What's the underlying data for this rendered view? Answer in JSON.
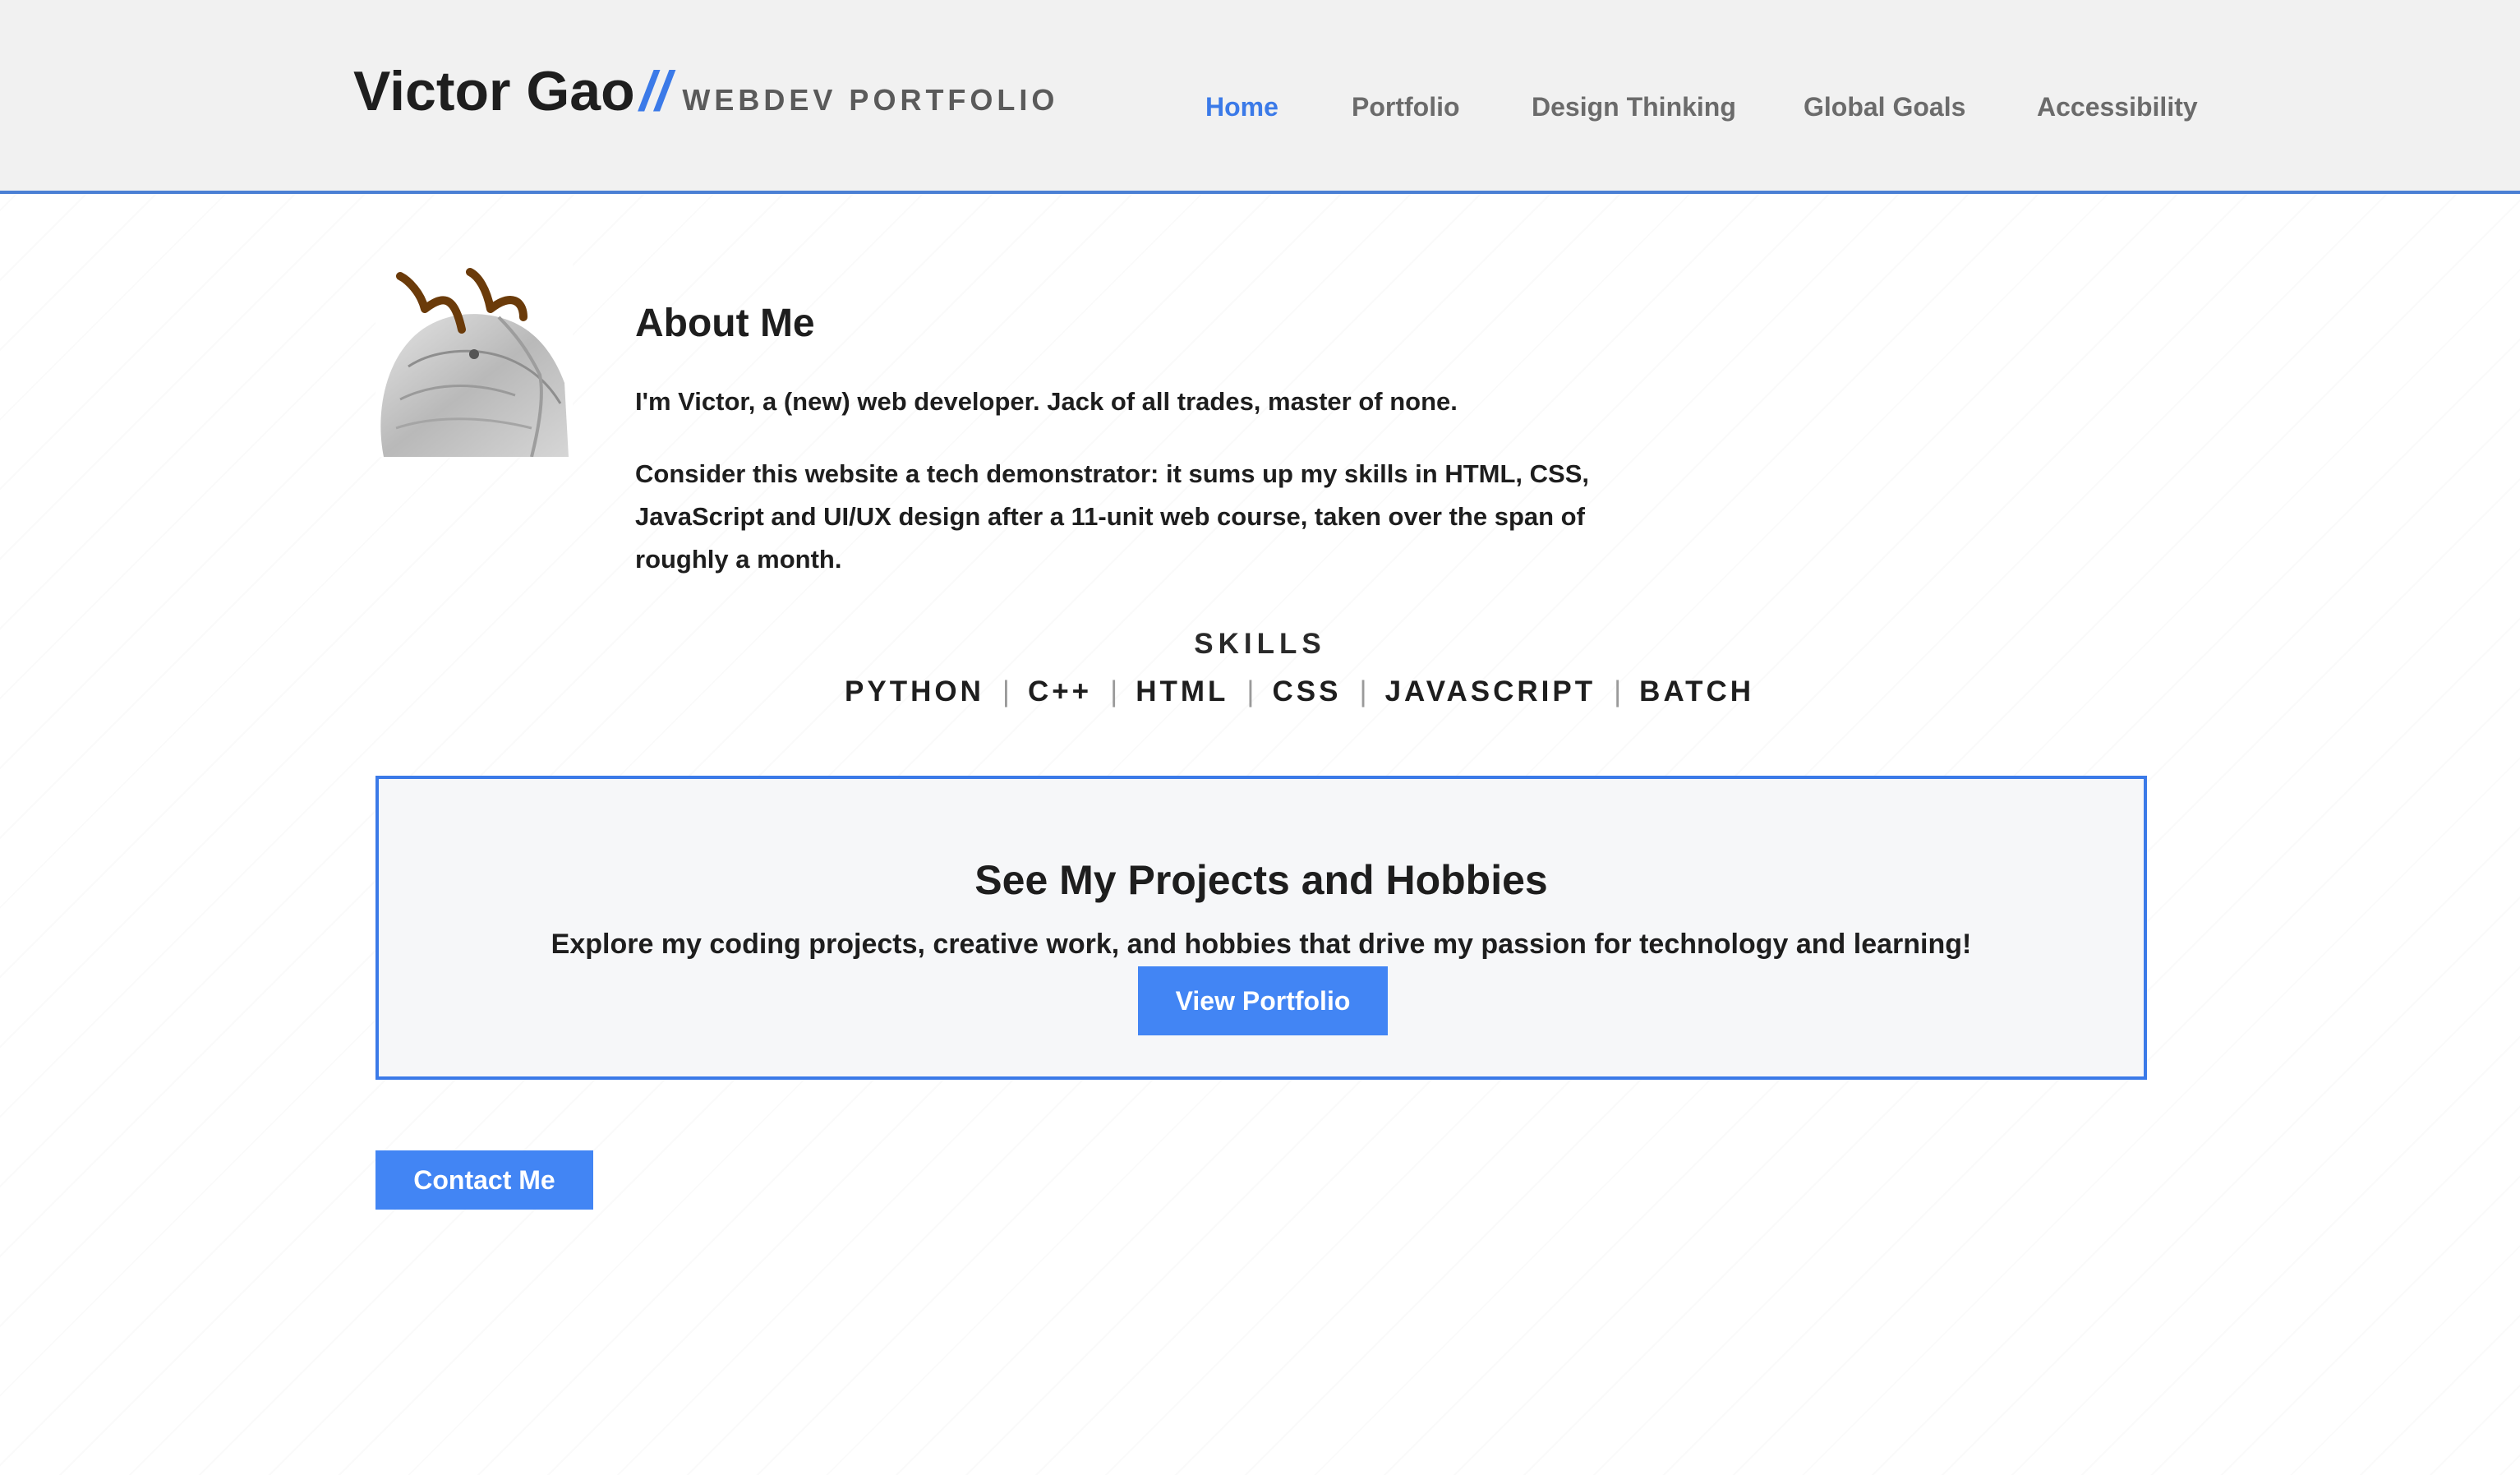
{
  "header": {
    "brand_name": "Victor Gao",
    "brand_slash": "//",
    "brand_sub": "WEBDEV PORTFOLIO",
    "nav": [
      {
        "label": "Home",
        "active": true
      },
      {
        "label": "Portfolio",
        "active": false
      },
      {
        "label": "Design Thinking",
        "active": false
      },
      {
        "label": "Global Goals",
        "active": false
      },
      {
        "label": "Accessibility",
        "active": false
      }
    ]
  },
  "about": {
    "title": "About Me",
    "p1": "I'm Victor, a (new) web developer. Jack of all trades, master of none.",
    "p2": "Consider this website a tech demonstrator: it sums up my skills in HTML, CSS, JavaScript and UI/UX design after a 11-unit web course, taken over the span of roughly a month.",
    "avatar_icon": "dragon-avatar"
  },
  "skills": {
    "title": "SKILLS",
    "items": [
      "PYTHON",
      "C++",
      "HTML",
      "CSS",
      "JAVASCRIPT",
      "BATCH"
    ],
    "separator": "|"
  },
  "cta": {
    "title": "See My Projects and Hobbies",
    "text": "Explore my coding projects, creative work, and hobbies that drive my passion for technology and learning!",
    "button_label": "View Portfolio"
  },
  "contact": {
    "button_label": "Contact Me"
  },
  "colors": {
    "accent": "#3b7ae8",
    "button": "#4285f4",
    "header_bg": "#f1f1f1"
  }
}
